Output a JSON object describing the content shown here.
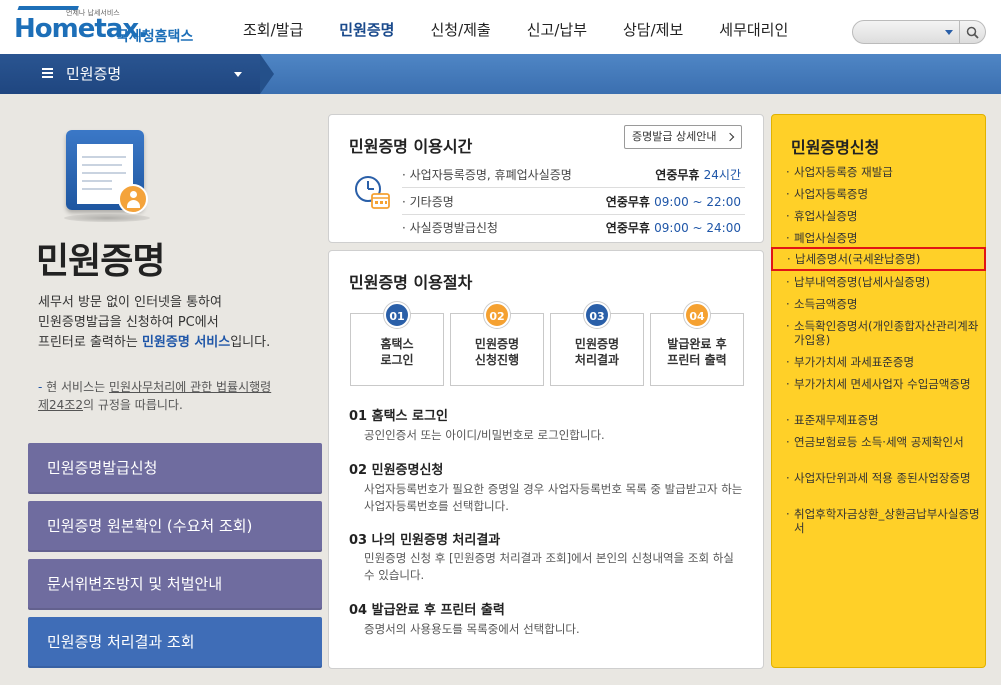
{
  "header": {
    "logo_main": "Hometax.",
    "logo_tagline": "언제나 납세서비스",
    "logo_kor": "국세청홈택스",
    "nav": [
      "조회/발급",
      "민원증명",
      "신청/제출",
      "신고/납부",
      "상담/제보",
      "세무대리인"
    ],
    "active_nav": 1,
    "search_placeholder": ""
  },
  "subnav": {
    "title": "민원증명"
  },
  "left": {
    "title": "민원증명",
    "intro_1": "세무서 방문 없이 인터넷을 통하여",
    "intro_2": "민원증명발급을 신청하여 PC에서",
    "intro_3a": "프린터로 출력하는 ",
    "intro_3b": "민원증명 서비스",
    "intro_3c": "입니다.",
    "notice_dash": "-",
    "notice_a": " 현 서비스는 ",
    "notice_b": "민원사무처리에 관한 법률시행령",
    "notice_c": "제24조2",
    "notice_d": "의 규정을 따릅니다.",
    "buttons": [
      "민원증명발급신청",
      "민원증명 원본확인 (수요처 조회)",
      "문서위변조방지 및 처벌안내",
      "민원증명 처리결과 조회"
    ]
  },
  "usage_time": {
    "title": "민원증명 이용시간",
    "detail_button": "증명발급 상세안내",
    "rows": [
      {
        "label": "· 사업자등록증명, 휴폐업사실증명",
        "prefix": "연중무휴 ",
        "time": "24시간"
      },
      {
        "label": "· 기타증명",
        "prefix": "연중무휴 ",
        "time": "09:00 ~ 22:00"
      },
      {
        "label": "· 사실증명발급신청",
        "prefix": "연중무휴 ",
        "time": "09:00 ~ 24:00"
      }
    ]
  },
  "procedure": {
    "title": "민원증명 이용절차",
    "steps": [
      {
        "num": "01",
        "line1": "홈택스",
        "line2": "로그인"
      },
      {
        "num": "02",
        "line1": "민원증명",
        "line2": "신청진행"
      },
      {
        "num": "03",
        "line1": "민원증명",
        "line2": "처리결과"
      },
      {
        "num": "04",
        "line1": "발급완료 후",
        "line2": "프린터 출력"
      }
    ],
    "details": [
      {
        "head": "01 홈택스 로그인",
        "desc": "공인인증서 또는 아이디/비밀번호로 로그인합니다."
      },
      {
        "head": "02 민원증명신청",
        "desc": "사업자등록번호가 필요한 증명일 경우 사업자등록번호 목록 중 발급받고자 하는 사업자등록번호를 선택합니다."
      },
      {
        "head": "03 나의 민원증명 처리결과",
        "desc": "민원증명 신청 후 [민원증명 처리결과 조회]에서 본인의 신청내역을 조회 하실 수 있습니다."
      },
      {
        "head": "04 발급완료 후 프린터 출력",
        "desc": "증명서의 사용용도를 목록중에서 선택합니다."
      }
    ]
  },
  "right": {
    "title": "민원증명신청",
    "links": [
      "사업자등록증 재발급",
      "사업자등록증명",
      "휴업사실증명",
      "폐업사실증명",
      "납세증명서(국세완납증명)",
      "납부내역증명(납세사실증명)",
      "소득금액증명",
      "소득확인증명서(개인종합자산관리계좌 가입용)",
      "부가가치세 과세표준증명",
      "부가가치세 면세사업자 수입금액증명",
      "표준재무제표증명",
      "연금보험료등 소득·세액 공제확인서",
      "사업자단위과세 적용 종된사업장증명",
      "취업후학자금상환_상환금납부사실증명서"
    ],
    "highlight_index": 4
  },
  "colors": {
    "brand_blue": "#1d6fb8",
    "highlight_border": "#e11515",
    "panel_yellow": "#ffd028",
    "step_orange": "#f5a131"
  }
}
